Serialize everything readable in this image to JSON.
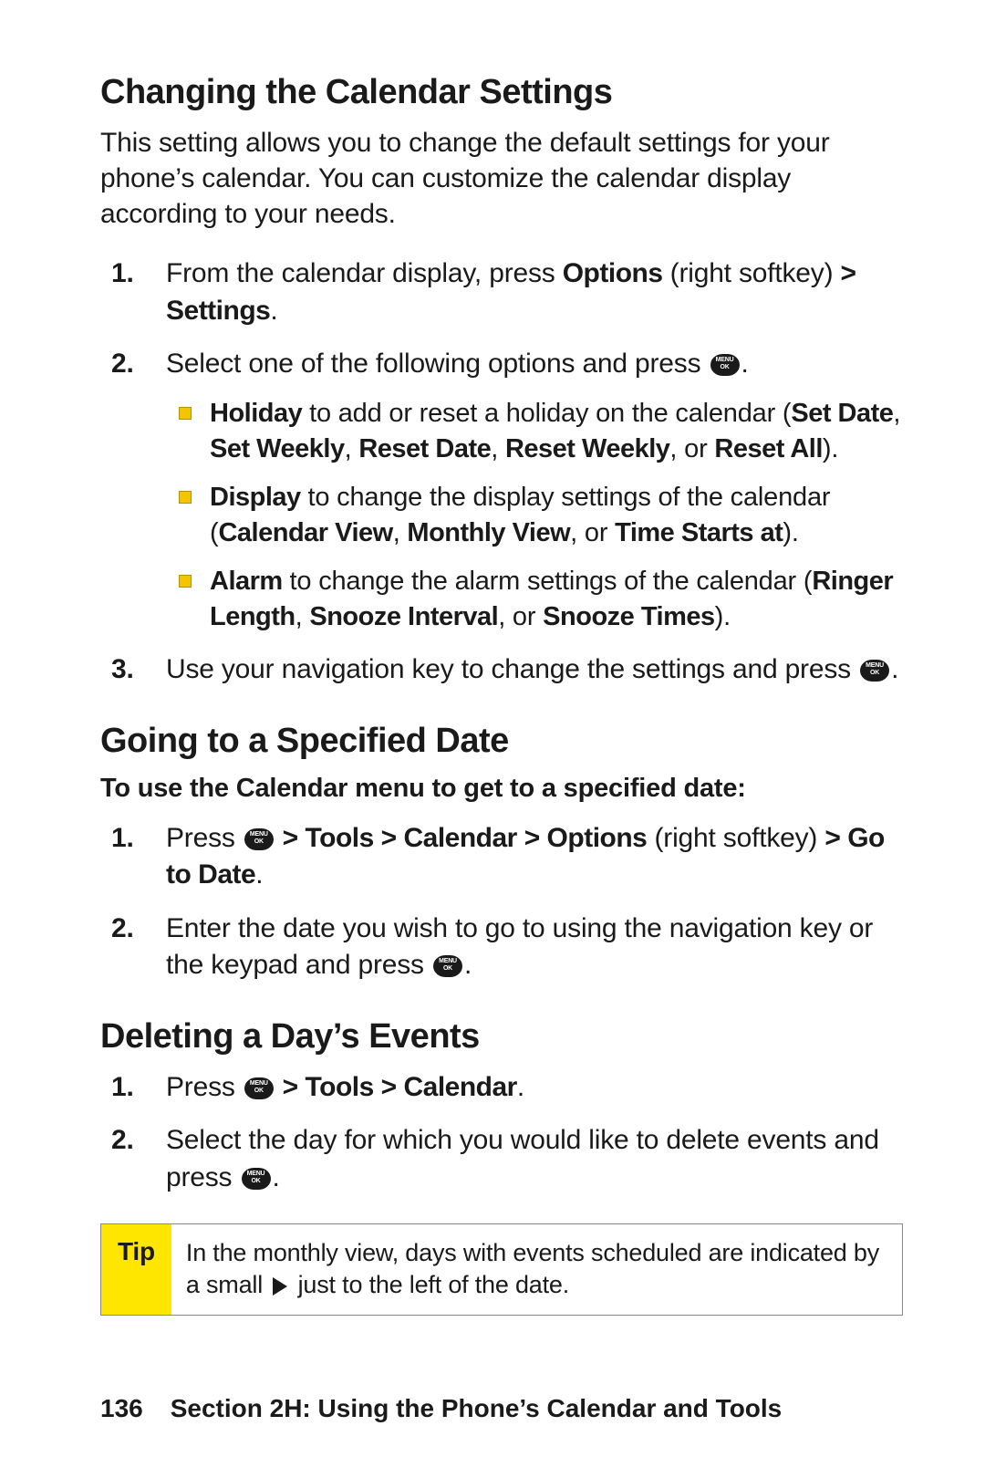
{
  "sections": {
    "s1": {
      "title": "Changing the Calendar Settings",
      "intro": "This setting allows you to change the default settings for your phone’s calendar. You can customize the calendar display according to your needs.",
      "step1_a": "From the calendar display, press ",
      "step1_b1": "Options",
      "step1_c": " (right softkey) ",
      "step1_b2": "> Settings",
      "step1_d": ".",
      "step2_a": "Select one of the following options and press ",
      "step2_b": ".",
      "sub1_b1": "Holiday",
      "sub1_a": " to add or reset a holiday on the calendar (",
      "sub1_b2": "Set Date",
      "sub1_s1": ", ",
      "sub1_b3": "Set Weekly",
      "sub1_s2": ", ",
      "sub1_b4": "Reset Date",
      "sub1_s3": ", ",
      "sub1_b5": "Reset Weekly",
      "sub1_s4": ", or ",
      "sub1_b6": "Reset All",
      "sub1_c": ").",
      "sub2_b1": "Display",
      "sub2_a": " to change the display settings of the calendar (",
      "sub2_b2": "Calendar View",
      "sub2_s1": ", ",
      "sub2_b3": "Monthly View",
      "sub2_s2": ", or ",
      "sub2_b4": "Time Starts at",
      "sub2_c": ").",
      "sub3_b1": "Alarm",
      "sub3_a": " to change the alarm settings of the calendar (",
      "sub3_b2": "Ringer Length",
      "sub3_s1": ", ",
      "sub3_b3": "Snooze Interval",
      "sub3_s2": ", or ",
      "sub3_b4": "Snooze Times",
      "sub3_c": ").",
      "step3_a": "Use your navigation key to change the settings and press ",
      "step3_b": "."
    },
    "s2": {
      "title": "Going to a Specified Date",
      "subhead": "To use the Calendar menu to get to a specified date:",
      "step1_a": "Press ",
      "step1_b1": " > Tools > Calendar > Options",
      "step1_c": " (right softkey) ",
      "step1_b2": "> Go to Date",
      "step1_d": ".",
      "step2_a": "Enter the date you wish to go to using the navigation key or the keypad and press ",
      "step2_b": "."
    },
    "s3": {
      "title": "Deleting a Day’s Events",
      "step1_a": "Press ",
      "step1_b1": " > Tools > Calendar",
      "step1_d": ".",
      "step2_a": "Select the day for which you would like to delete events and press ",
      "step2_b": "."
    }
  },
  "tip": {
    "label": "Tip",
    "text_a": "In the monthly view, days with events scheduled are indicated by a small ",
    "text_b": " just to the left of the date."
  },
  "footer": {
    "page": "136",
    "section": "Section 2H: Using the Phone’s Calendar and Tools"
  }
}
